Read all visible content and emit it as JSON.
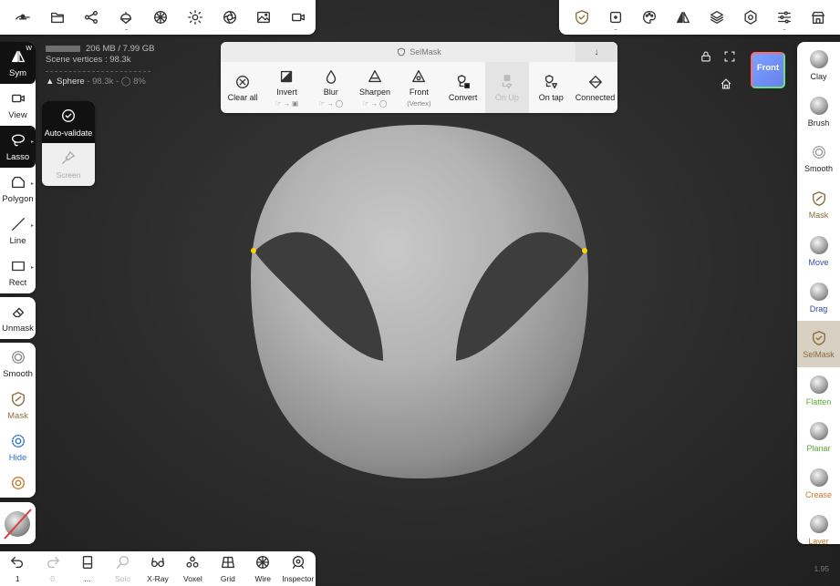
{
  "top_left_toolbar": {
    "items": [
      {
        "name": "menu-icon"
      },
      {
        "name": "folder-icon"
      },
      {
        "name": "share-icon"
      },
      {
        "name": "scene-icon"
      },
      {
        "name": "mesh-icon"
      },
      {
        "name": "light-icon"
      },
      {
        "name": "camera-icon"
      },
      {
        "name": "background-icon"
      },
      {
        "name": "video-icon"
      }
    ]
  },
  "top_right_toolbar": {
    "items": [
      {
        "name": "selmask-tool-icon"
      },
      {
        "name": "select-icon"
      },
      {
        "name": "paint-icon"
      },
      {
        "name": "symmetry-icon"
      },
      {
        "name": "layers-icon"
      },
      {
        "name": "settings-icon"
      },
      {
        "name": "sliders-icon"
      },
      {
        "name": "store-icon"
      }
    ]
  },
  "scene_info": {
    "memory": "206 MB / 7.99 GB",
    "vertices": "Scene vertices : 98.3k",
    "object_name": "Sphere",
    "object_stats": "- 98.3k - ",
    "object_mask": "8%"
  },
  "left_toolbar": {
    "sym_label": "Sym",
    "sym_tag": "W",
    "view_label": "View",
    "lasso_label": "Lasso",
    "polygon_label": "Polygon",
    "line_label": "Line",
    "rect_label": "Rect",
    "unmask_label": "Unmask",
    "smooth_label": "Smooth",
    "mask_label": "Mask",
    "hide_label": "Hide"
  },
  "lasso_popup": {
    "auto_validate": "Auto-validate",
    "screen": "Screen"
  },
  "selmask_panel": {
    "title": "SelMask",
    "buttons": [
      {
        "label": "Clear all",
        "sub": ""
      },
      {
        "label": "Invert",
        "sub": ""
      },
      {
        "label": "Blur",
        "sub": ""
      },
      {
        "label": "Sharpen",
        "sub": ""
      },
      {
        "label": "Front",
        "sub": "(Vertex)"
      },
      {
        "label": "Convert",
        "sub": ""
      },
      {
        "label": "On Up",
        "sub": ""
      },
      {
        "label": "On tap",
        "sub": ""
      },
      {
        "label": "Connected",
        "sub": ""
      }
    ]
  },
  "view_cube": {
    "label": "Front"
  },
  "right_toolbar": {
    "tools": [
      {
        "label": "Clay",
        "color": "#222222"
      },
      {
        "label": "Brush",
        "color": "#222222"
      },
      {
        "label": "Smooth",
        "color": "#222222"
      },
      {
        "label": "Mask",
        "color": "#8a6d3b"
      },
      {
        "label": "Move",
        "color": "#3a4aa8"
      },
      {
        "label": "Drag",
        "color": "#3a4aa8"
      },
      {
        "label": "SelMask",
        "color": "#8a6d3b"
      },
      {
        "label": "Flatten",
        "color": "#5aa832"
      },
      {
        "label": "Planar",
        "color": "#5aa832"
      },
      {
        "label": "Crease",
        "color": "#c9782a"
      },
      {
        "label": "Layer",
        "color": "#c9782a"
      }
    ]
  },
  "bottom_toolbar": {
    "undo_label": "1",
    "redo_label": "0",
    "history_label": "...",
    "solo_label": "Solo",
    "xray_label": "X-Ray",
    "voxel_label": "Voxel",
    "grid_label": "Grid",
    "wire_label": "Wire",
    "inspector_label": "Inspector"
  },
  "version": "1.95",
  "colors": {
    "accent_active": "#111111",
    "selmask_active_bg": "#d8d0c2",
    "mask_color": "#3b3b3b",
    "marker_color": "#ffd400"
  }
}
